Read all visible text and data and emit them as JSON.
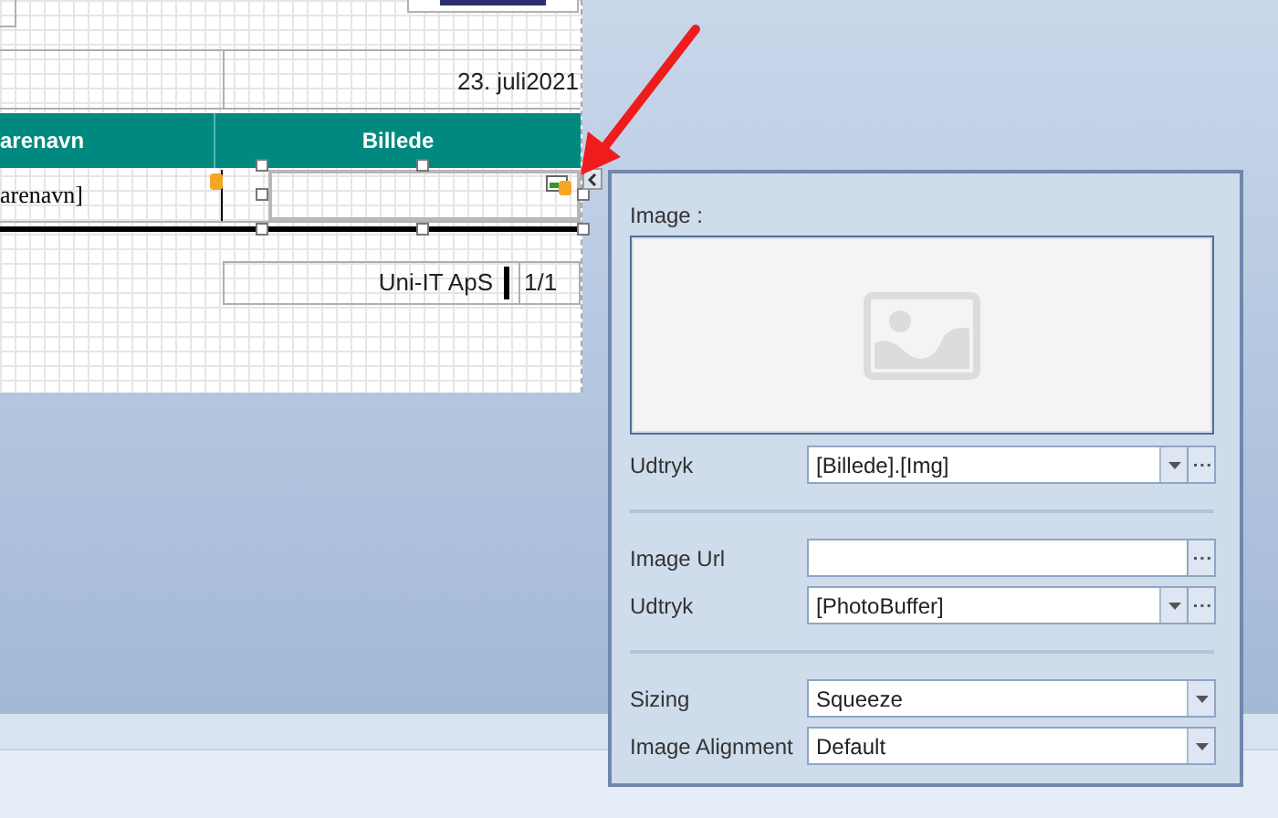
{
  "report": {
    "date": "23. juli2021",
    "headers": [
      "arenavn",
      "Billede"
    ],
    "field": "arenavn]",
    "company": "Uni-IT ApS",
    "page": "1/1"
  },
  "panel": {
    "image_label": "Image :",
    "rows": [
      {
        "kind": "combo",
        "label": "Udtryk",
        "value": "[Billede].[Img]"
      },
      {
        "kind": "separator"
      },
      {
        "kind": "text",
        "label": "Image Url"
      },
      {
        "kind": "combo",
        "label": "Udtryk",
        "value": "[PhotoBuffer]"
      },
      {
        "kind": "separator"
      },
      {
        "kind": "dropdown",
        "label": "Sizing",
        "value": "Squeeze"
      },
      {
        "kind": "dropdown",
        "label": "Image Alignment",
        "value": "Default"
      }
    ]
  }
}
